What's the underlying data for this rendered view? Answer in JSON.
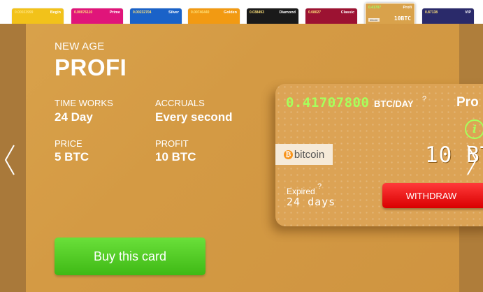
{
  "thumbnails": [
    {
      "name": "Begin",
      "value": "0.00023999",
      "color": "#f2c21a"
    },
    {
      "name": "Prime",
      "value": "0.00076110",
      "color": "#e0157a"
    },
    {
      "name": "Silver",
      "value": "0.00232704",
      "color": "#1a62c8"
    },
    {
      "name": "Golden",
      "value": "0.00746440",
      "color": "#f29a12"
    },
    {
      "name": "Diamond",
      "value": "0.038493",
      "color": "#1a1a1a"
    },
    {
      "name": "Classic",
      "value": "0.08027",
      "color": "#9c1232"
    },
    {
      "name": "Profi",
      "value": "0.41707",
      "color": "#d9a24b",
      "active": true,
      "amount": "10BTC",
      "badge": "bitcoin"
    },
    {
      "name": "VIP",
      "value": "0.87138",
      "color": "#2a2a6a"
    }
  ],
  "plan": {
    "subtitle": "NEW AGE",
    "title": "PROFI",
    "time_works_label": "TIME WORKS",
    "time_works_value": "24 Day",
    "accruals_label": "ACCRUALS",
    "accruals_value": "Every second",
    "price_label": "PRICE",
    "price_value": "5 BTC",
    "profit_label": "PROFIT",
    "profit_value": "10 BTC",
    "buy_label": "Buy this card"
  },
  "card": {
    "rate": "0.41707800",
    "rate_unit": "BTC/DAY",
    "help_mark": "?",
    "name": "Pro",
    "info_icon": "i",
    "bitcoin_label": "bitcoin",
    "amount": "10 BT",
    "expired_label": "Expired",
    "days": "24 days",
    "withdraw_label": "WITHDRAW"
  },
  "colors": {
    "accent": "#d9a24b",
    "rate": "#a7ff5c",
    "buy": "#4cc520",
    "withdraw": "#e81010"
  }
}
